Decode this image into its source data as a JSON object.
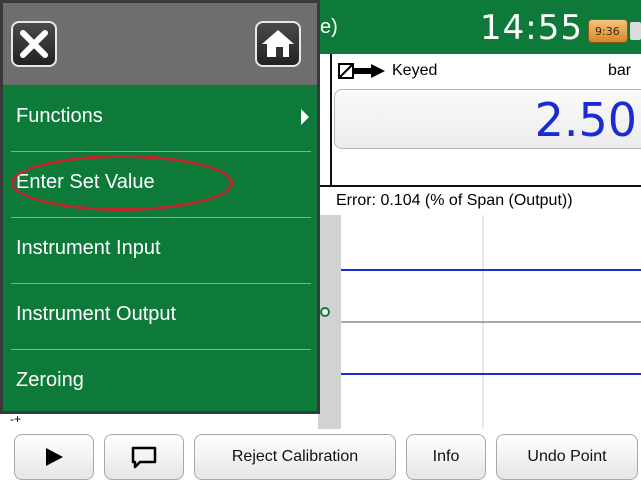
{
  "header": {
    "title_fragment": "e)",
    "clock": "14:55",
    "battery_time": "9:36"
  },
  "colors": {
    "accent": "#0e7a3a",
    "value": "#1a2bd1",
    "highlight": "#c0262c",
    "graph_line": "#1a2bd1"
  },
  "reading": {
    "source": "Keyed",
    "source_icon": "keyed-arrow-icon",
    "unit": "bar",
    "value": "2.50"
  },
  "graph": {
    "error_label": "Error: 0.104 (% of Span (Output))"
  },
  "menu": {
    "close_icon": "close-icon",
    "home_icon": "home-icon",
    "items": [
      {
        "label": "Functions",
        "has_submenu": true
      },
      {
        "label": "Enter Set Value",
        "has_submenu": false
      },
      {
        "label": "Instrument Input",
        "has_submenu": false
      },
      {
        "label": "Instrument Output",
        "has_submenu": false
      },
      {
        "label": "Zeroing",
        "has_submenu": false
      }
    ]
  },
  "toolbar": {
    "play_icon": "play-icon",
    "comment_icon": "comment-icon",
    "reject_label": "Reject Calibration",
    "info_label": "Info",
    "undo_label": "Undo Point"
  }
}
